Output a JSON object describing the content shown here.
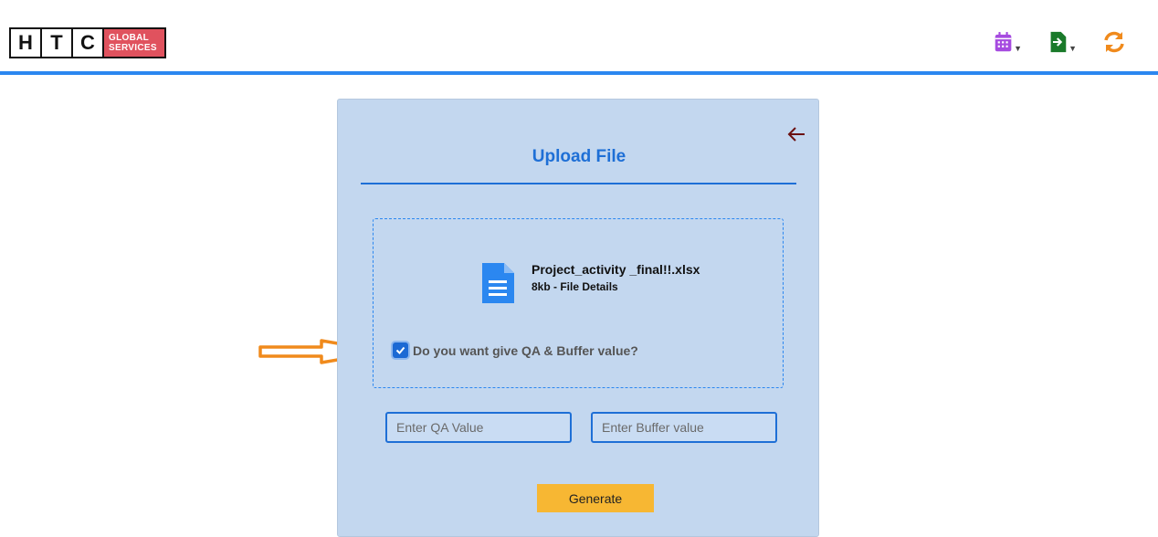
{
  "header": {
    "logo_letters": [
      "H",
      "T",
      "C"
    ],
    "logo_brand_line1": "GLOBAL",
    "logo_brand_line2": "SERVICES",
    "icons": [
      "calendar-icon",
      "export-file-icon",
      "refresh-icon"
    ],
    "colors": {
      "accent_line": "#2b87f0",
      "calendar": "#a64be0",
      "export": "#1a7a2a",
      "refresh": "#f08a1c",
      "logo_brand": "#e0525e"
    }
  },
  "card": {
    "title": "Upload File",
    "back_icon": "arrow-left-icon",
    "file": {
      "icon": "document-icon",
      "name": "Project_activity _final!!.xlsx",
      "detail": "8kb -  File Details"
    },
    "checkbox": {
      "checked": true,
      "label": "Do you want give QA & Buffer value?"
    },
    "qa_input": {
      "value": "",
      "placeholder": "Enter QA Value"
    },
    "buffer_input": {
      "value": "",
      "placeholder": "Enter Buffer value"
    },
    "generate_label": "Generate",
    "colors": {
      "card_bg": "#c3d7ef",
      "title": "#1e6fd6",
      "button": "#f7b733",
      "annotation_arrow": "#f08a1c"
    }
  }
}
